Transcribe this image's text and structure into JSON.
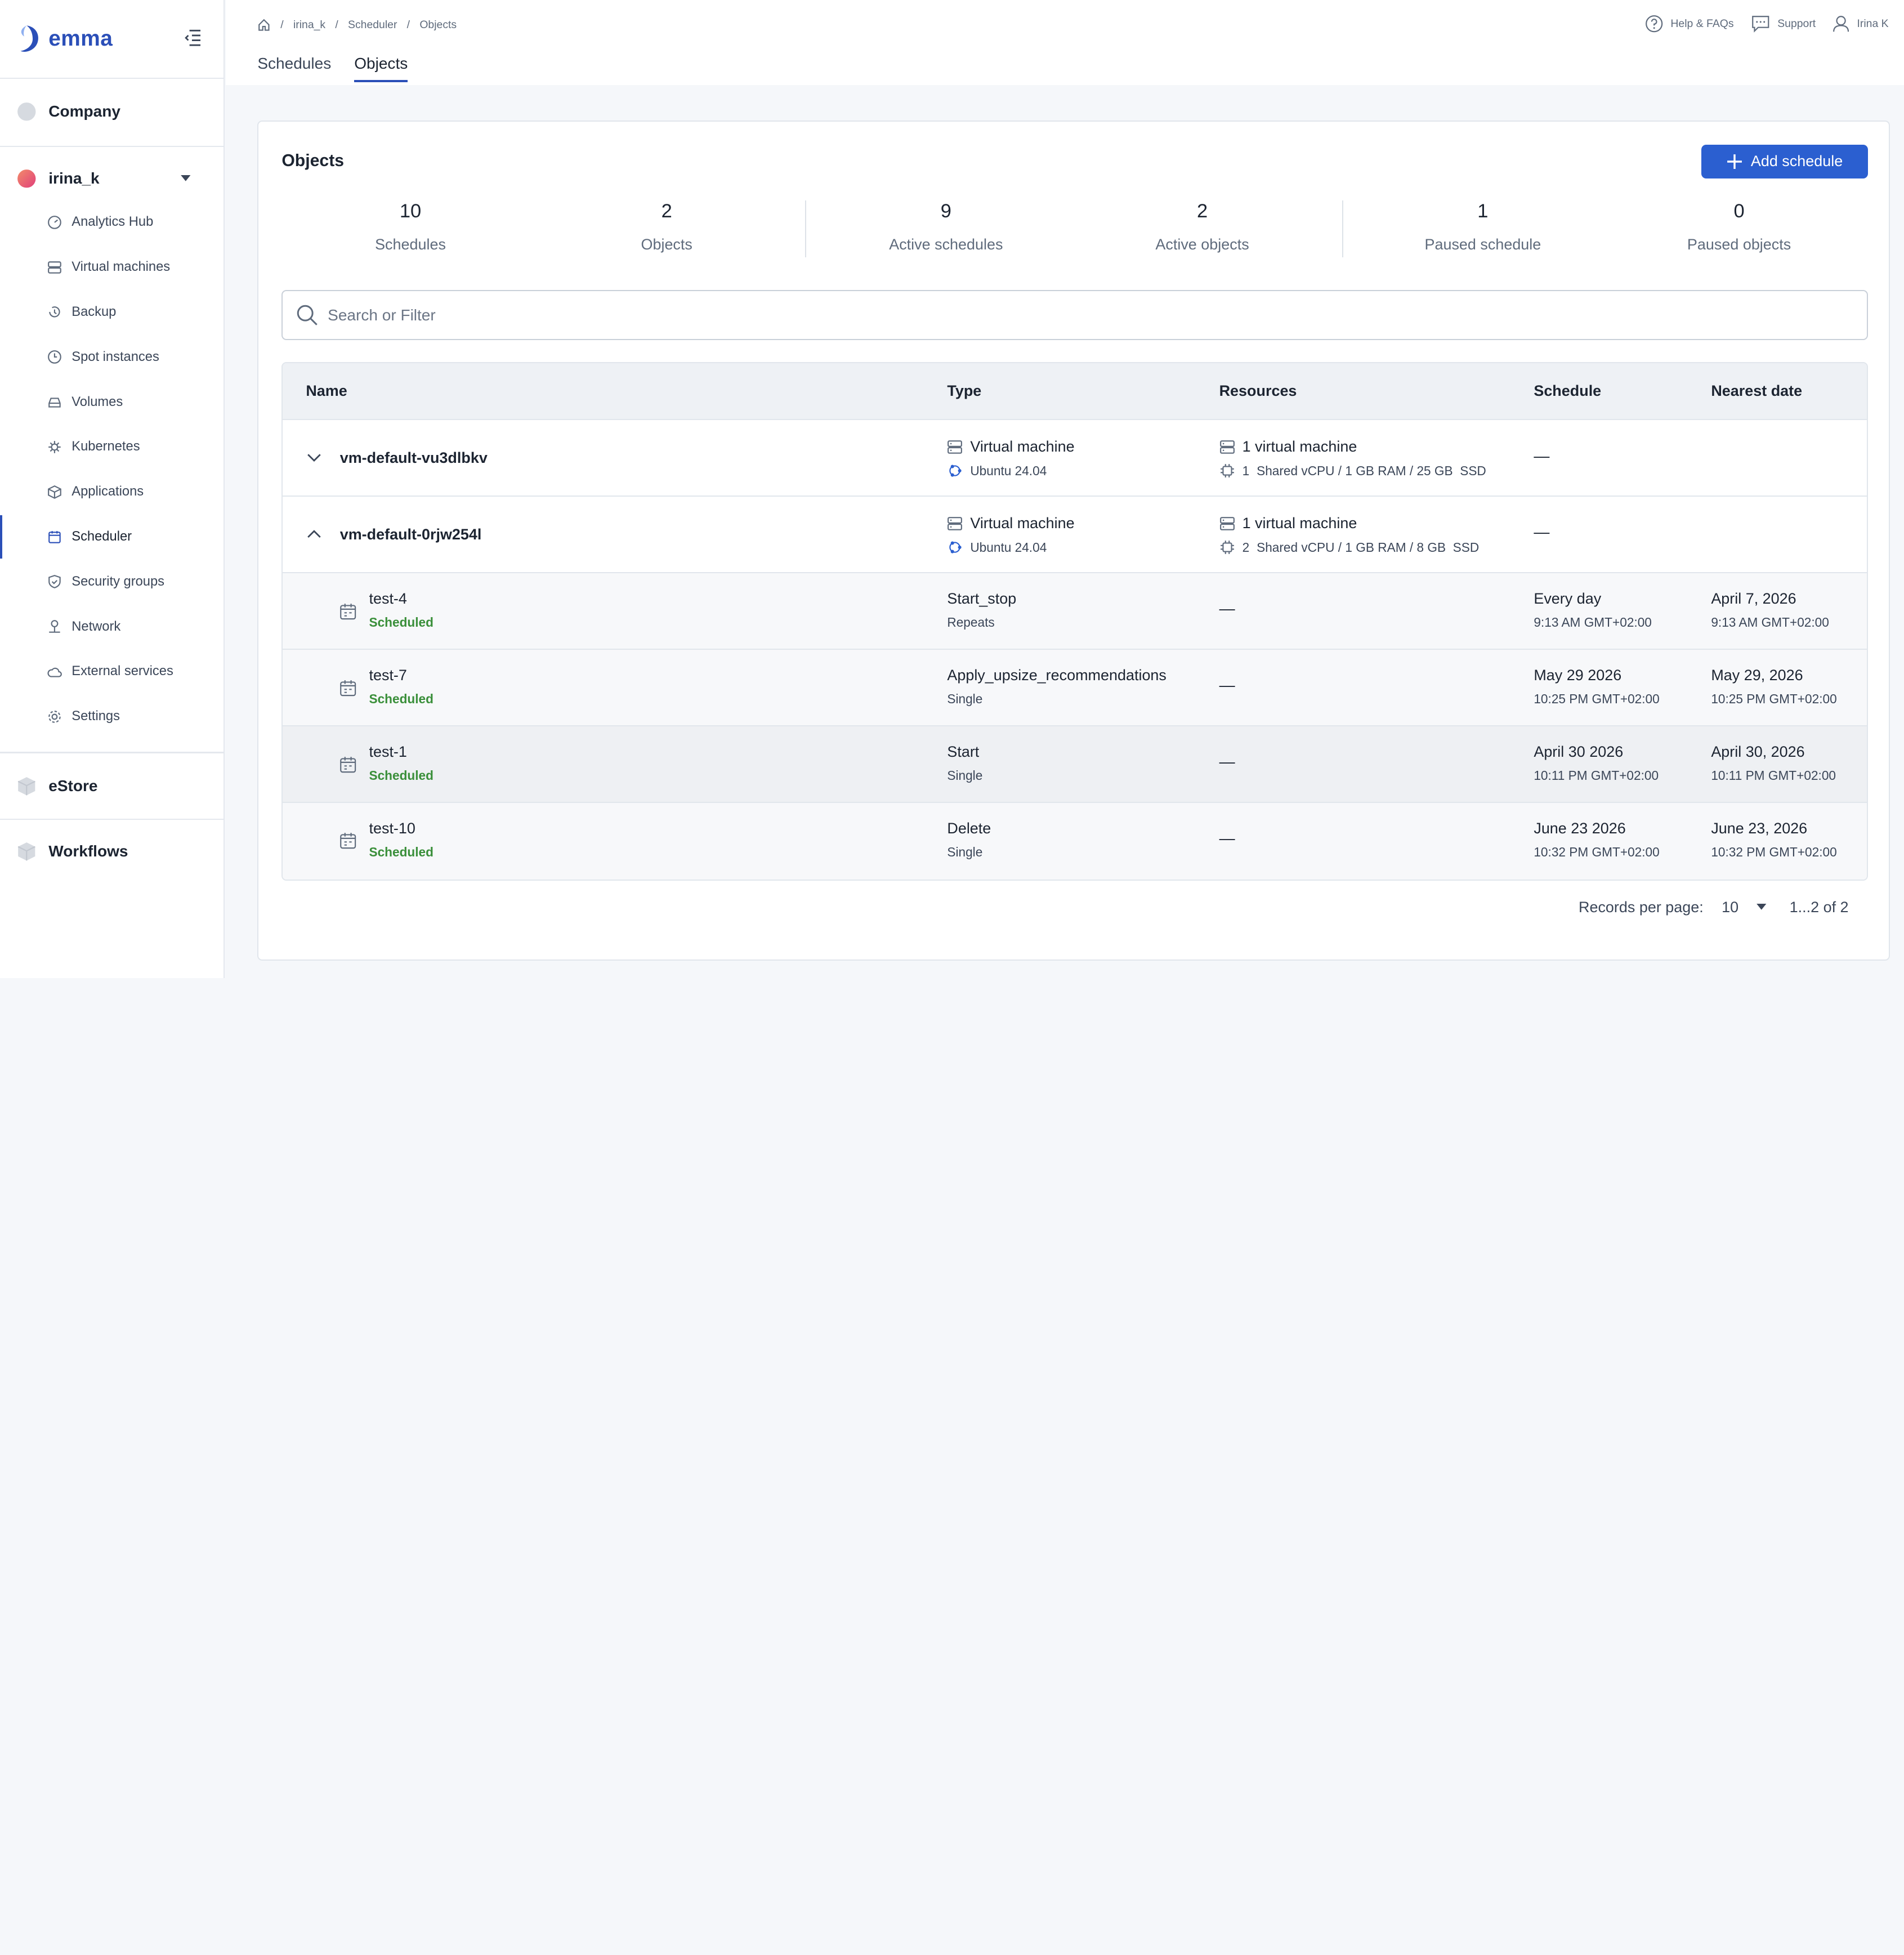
{
  "app": {
    "logo_text": "emma"
  },
  "sidebar": {
    "sections": {
      "company": "Company",
      "project": "irina_k",
      "estore": "eStore",
      "workflows": "Workflows"
    },
    "items": [
      {
        "label": "Analytics Hub",
        "icon": "gauge-icon"
      },
      {
        "label": "Virtual machines",
        "icon": "server-icon"
      },
      {
        "label": "Backup",
        "icon": "backup-icon"
      },
      {
        "label": "Spot instances",
        "icon": "clock-icon"
      },
      {
        "label": "Volumes",
        "icon": "volume-icon"
      },
      {
        "label": "Kubernetes",
        "icon": "kubernetes-icon"
      },
      {
        "label": "Applications",
        "icon": "cube-icon"
      },
      {
        "label": "Scheduler",
        "icon": "calendar-icon",
        "active": true
      },
      {
        "label": "Security groups",
        "icon": "shield-icon"
      },
      {
        "label": "Network",
        "icon": "network-icon"
      },
      {
        "label": "External services",
        "icon": "cloud-icon"
      },
      {
        "label": "Settings",
        "icon": "gear-icon"
      }
    ]
  },
  "header": {
    "breadcrumb": [
      "irina_k",
      "Scheduler",
      "Objects"
    ],
    "tabs": [
      "Schedules",
      "Objects"
    ],
    "active_tab": "Objects",
    "help": "Help & FAQs",
    "support": "Support",
    "user": "Irina K"
  },
  "card": {
    "title": "Objects",
    "add_button": "Add schedule",
    "stats": [
      {
        "value": "10",
        "label": "Schedules"
      },
      {
        "value": "2",
        "label": "Objects"
      },
      {
        "value": "9",
        "label": "Active schedules"
      },
      {
        "value": "2",
        "label": "Active objects"
      },
      {
        "value": "1",
        "label": "Paused schedule"
      },
      {
        "value": "0",
        "label": "Paused objects"
      }
    ],
    "search_placeholder": "Search or Filter"
  },
  "table": {
    "columns": [
      "Name",
      "Type",
      "Resources",
      "Schedule",
      "Nearest date"
    ],
    "objects": [
      {
        "name": "vm-default-vu3dlbkv",
        "type": "Virtual machine",
        "os": "Ubuntu 24.04",
        "resources": "1 virtual machine",
        "specs_count": "1",
        "specs": "Shared vCPU / 1 GB RAM / 25 GB  SSD",
        "schedule": "—",
        "expanded": false
      },
      {
        "name": "vm-default-0rjw254l",
        "type": "Virtual machine",
        "os": "Ubuntu 24.04",
        "resources": "1 virtual machine",
        "specs_count": "2",
        "specs": "Shared vCPU / 1 GB RAM / 8 GB  SSD",
        "schedule": "—",
        "expanded": true
      }
    ],
    "schedules": [
      {
        "name": "test-4",
        "status": "Scheduled",
        "type": "Start_stop",
        "mode": "Repeats",
        "resources": "—",
        "schedule": "Every day",
        "schedule_time": "9:13 AM GMT+02:00",
        "nearest": "April 7, 2026",
        "nearest_time": "9:13 AM GMT+02:00"
      },
      {
        "name": "test-7",
        "status": "Scheduled",
        "type": "Apply_upsize_recommendations",
        "mode": "Single",
        "resources": "—",
        "schedule": "May 29 2026",
        "schedule_time": "10:25 PM GMT+02:00",
        "nearest": "May 29, 2026",
        "nearest_time": "10:25 PM GMT+02:00"
      },
      {
        "name": "test-1",
        "status": "Scheduled",
        "type": "Start",
        "mode": "Single",
        "resources": "—",
        "schedule": "April 30 2026",
        "schedule_time": "10:11 PM GMT+02:00",
        "nearest": "April 30, 2026",
        "nearest_time": "10:11 PM GMT+02:00"
      },
      {
        "name": "test-10",
        "status": "Scheduled",
        "type": "Delete",
        "mode": "Single",
        "resources": "—",
        "schedule": "June 23 2026",
        "schedule_time": "10:32 PM GMT+02:00",
        "nearest": "June 23, 2026",
        "nearest_time": "10:32 PM GMT+02:00"
      }
    ]
  },
  "pagination": {
    "label": "Records per page:",
    "per_page": "10",
    "range": "1...2 of 2"
  },
  "colors": {
    "accent": "#2b5fd0",
    "status_scheduled": "#3a8f3a",
    "brand": "#2b4fb8"
  }
}
